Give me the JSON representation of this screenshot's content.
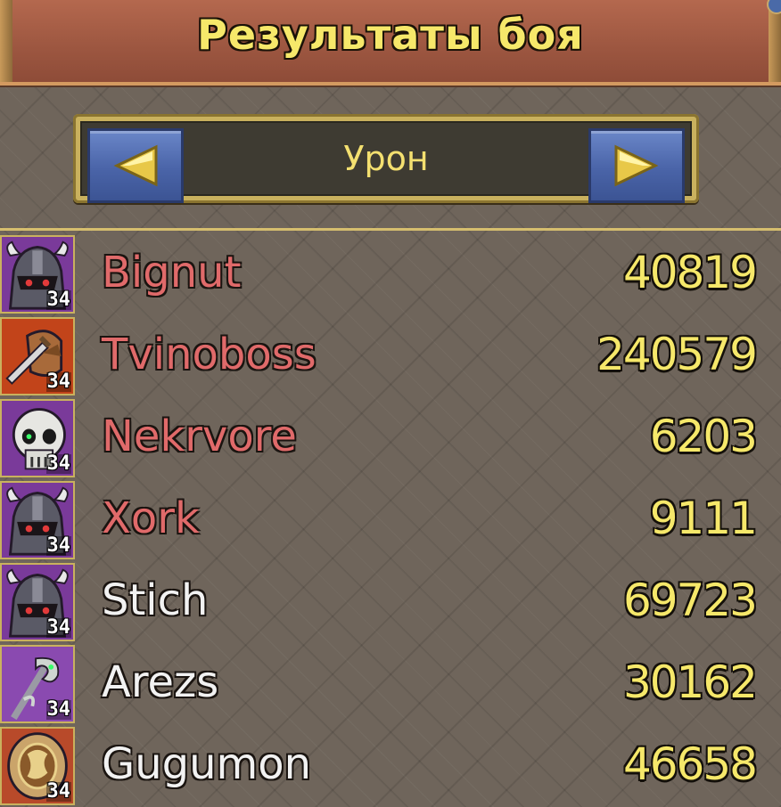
{
  "header": {
    "title": "Результаты боя"
  },
  "selector": {
    "label": "Урон",
    "prev_icon": "arrow-left-icon",
    "next_icon": "arrow-right-icon"
  },
  "colors": {
    "enemy_name": "#e06a6a",
    "ally_name": "#f2f2f2",
    "value": "#f6e86a",
    "header": "#9c5640",
    "button": "#4a64a8"
  },
  "players": [
    {
      "name": "Bignut",
      "value": "40819",
      "level": "34",
      "team": "enemy",
      "icon": "armored-helm-icon",
      "portrait_bg": "#7a3a9a"
    },
    {
      "name": "Tvinoboss",
      "value": "240579",
      "level": "34",
      "team": "enemy",
      "icon": "sword-warrior-icon",
      "portrait_bg": "#c2441a"
    },
    {
      "name": "Nekrvore",
      "value": "6203",
      "level": "34",
      "team": "enemy",
      "icon": "skull-icon",
      "portrait_bg": "#7a3a9a"
    },
    {
      "name": "Xork",
      "value": "9111",
      "level": "34",
      "team": "enemy",
      "icon": "armored-helm-icon",
      "portrait_bg": "#7a3a9a"
    },
    {
      "name": "Stich",
      "value": "69723",
      "level": "34",
      "team": "ally",
      "icon": "armored-helm-icon",
      "portrait_bg": "#7a3a9a"
    },
    {
      "name": "Arezs",
      "value": "30162",
      "level": "34",
      "team": "ally",
      "icon": "serpent-staff-icon",
      "portrait_bg": "#8a4ab0"
    },
    {
      "name": "Gugumon",
      "value": "46658",
      "level": "34",
      "team": "ally",
      "icon": "rune-shield-icon",
      "portrait_bg": "#b84a2a"
    }
  ]
}
